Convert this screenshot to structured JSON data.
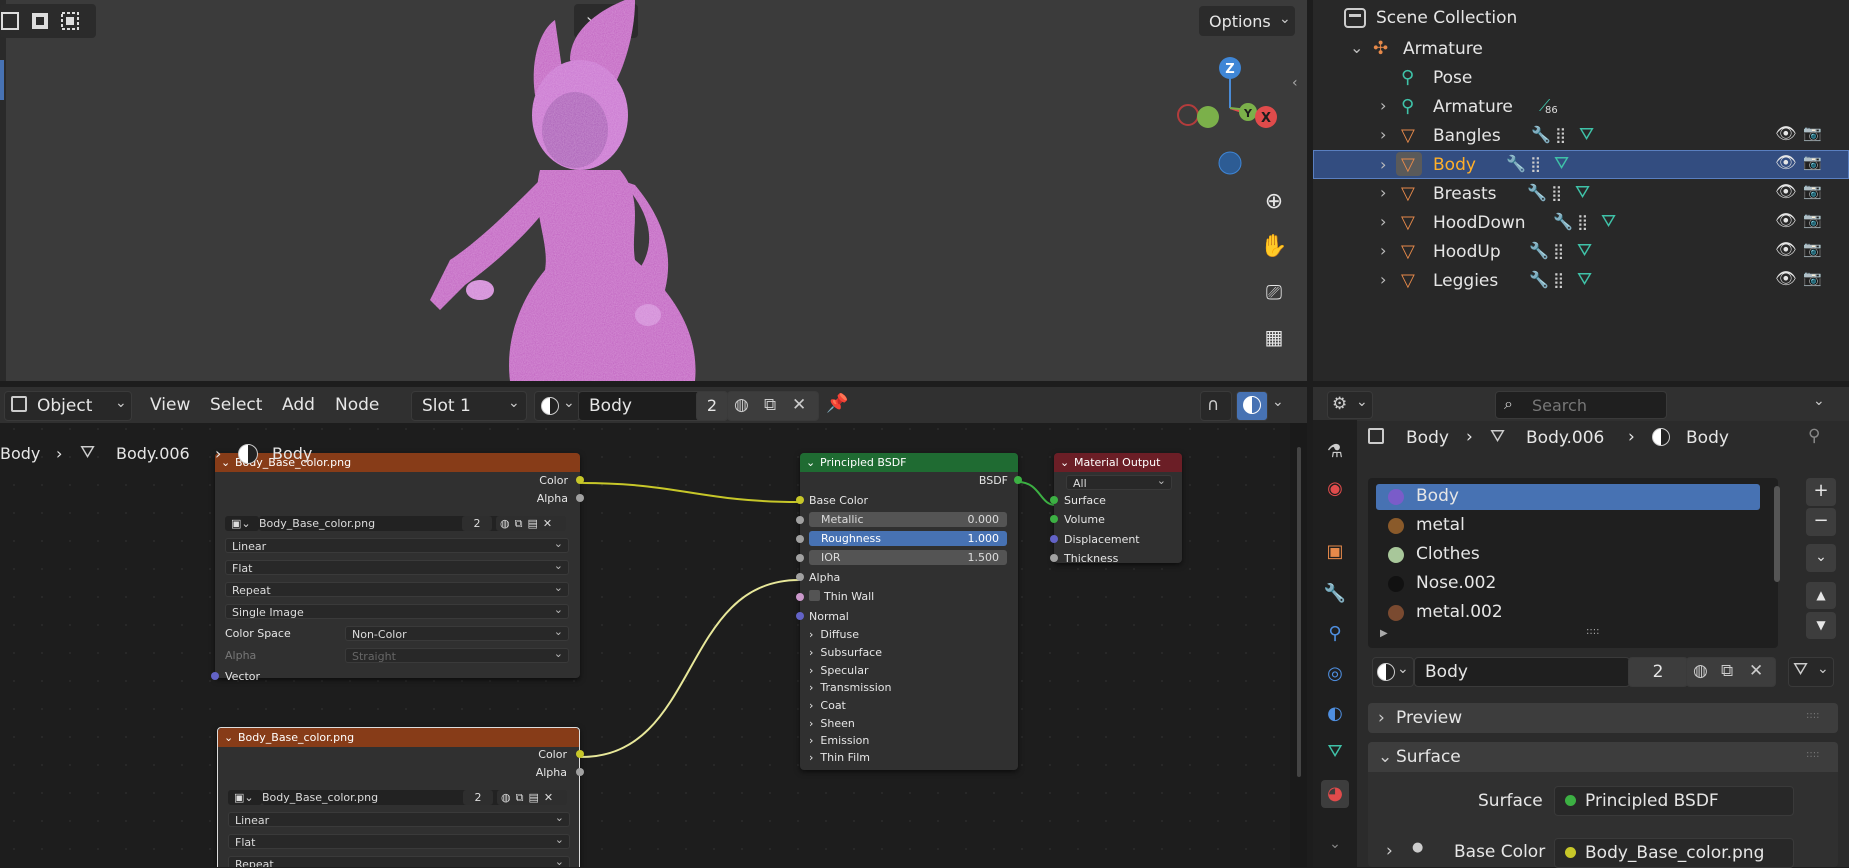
{
  "viewport": {
    "options_label": "Options",
    "gizmo": {
      "z": "Z",
      "y": "Y",
      "x": "X"
    },
    "colors": {
      "background": "#3b3b3b",
      "character": "#c663c6"
    }
  },
  "outliner": {
    "title": "Scene Collection",
    "rows": [
      {
        "label": "Armature",
        "icon": "armature-icon"
      },
      {
        "label": "Pose",
        "icon": "pose-icon"
      },
      {
        "label": "Armature",
        "icon": "armature-data-icon",
        "badge": "86"
      },
      {
        "label": "Bangles",
        "icon": "mesh-icon"
      },
      {
        "label": "Body",
        "icon": "mesh-icon",
        "selected": true
      },
      {
        "label": "Breasts",
        "icon": "mesh-icon"
      },
      {
        "label": "HoodDown",
        "icon": "mesh-icon"
      },
      {
        "label": "HoodUp",
        "icon": "mesh-icon"
      },
      {
        "label": "Leggies",
        "icon": "mesh-icon"
      }
    ]
  },
  "node_editor": {
    "header": {
      "mode": "Object",
      "menus": [
        "View",
        "Select",
        "Add",
        "Node"
      ],
      "slot": "Slot 1",
      "material": "Body",
      "users": "2"
    },
    "breadcrumb": {
      "object": "Body",
      "mesh": "Body.006",
      "material": "Body"
    },
    "image_node_1": {
      "title": "Body_Base_color.png",
      "out_color": "Color",
      "out_alpha": "Alpha",
      "image": "Body_Base_color.png",
      "users": "2",
      "interpolation": "Linear",
      "projection": "Flat",
      "extension": "Repeat",
      "source": "Single Image",
      "color_space_label": "Color Space",
      "color_space": "Non-Color",
      "alpha_label": "Alpha",
      "alpha_mode": "Straight",
      "vector": "Vector"
    },
    "image_node_2": {
      "title": "Body_Base_color.png",
      "out_color": "Color",
      "out_alpha": "Alpha",
      "image": "Body_Base_color.png",
      "users": "2",
      "interpolation": "Linear",
      "projection": "Flat",
      "extension": "Repeat"
    },
    "bsdf": {
      "title": "Principled BSDF",
      "output": "BSDF",
      "base_color": "Base Color",
      "metallic_label": "Metallic",
      "metallic": "0.000",
      "roughness_label": "Roughness",
      "roughness": "1.000",
      "ior_label": "IOR",
      "ior": "1.500",
      "alpha": "Alpha",
      "thin_wall": "Thin Wall",
      "normal": "Normal",
      "panels": [
        "Diffuse",
        "Subsurface",
        "Specular",
        "Transmission",
        "Coat",
        "Sheen",
        "Emission",
        "Thin Film"
      ]
    },
    "output": {
      "title": "Material Output",
      "target": "All",
      "inputs": [
        "Surface",
        "Volume",
        "Displacement",
        "Thickness"
      ]
    }
  },
  "properties": {
    "search_placeholder": "Search",
    "breadcrumb": {
      "object": "Body",
      "mesh": "Body.006",
      "material": "Body"
    },
    "materials": [
      {
        "label": "Body",
        "color": "#7a5cc9",
        "selected": true
      },
      {
        "label": "metal",
        "color": "#8a5a2a"
      },
      {
        "label": "Clothes",
        "color": "#a8c79a"
      },
      {
        "label": "Nose.002",
        "color": "#111111"
      },
      {
        "label": "metal.002",
        "color": "#7a4a30"
      }
    ],
    "material_name": "Body",
    "material_users": "2",
    "preview_label": "Preview",
    "surface_panel_label": "Surface",
    "surface_label": "Surface",
    "surface_value": "Principled BSDF",
    "base_color_label": "Base Color",
    "base_color_value": "Body_Base_color.png"
  }
}
